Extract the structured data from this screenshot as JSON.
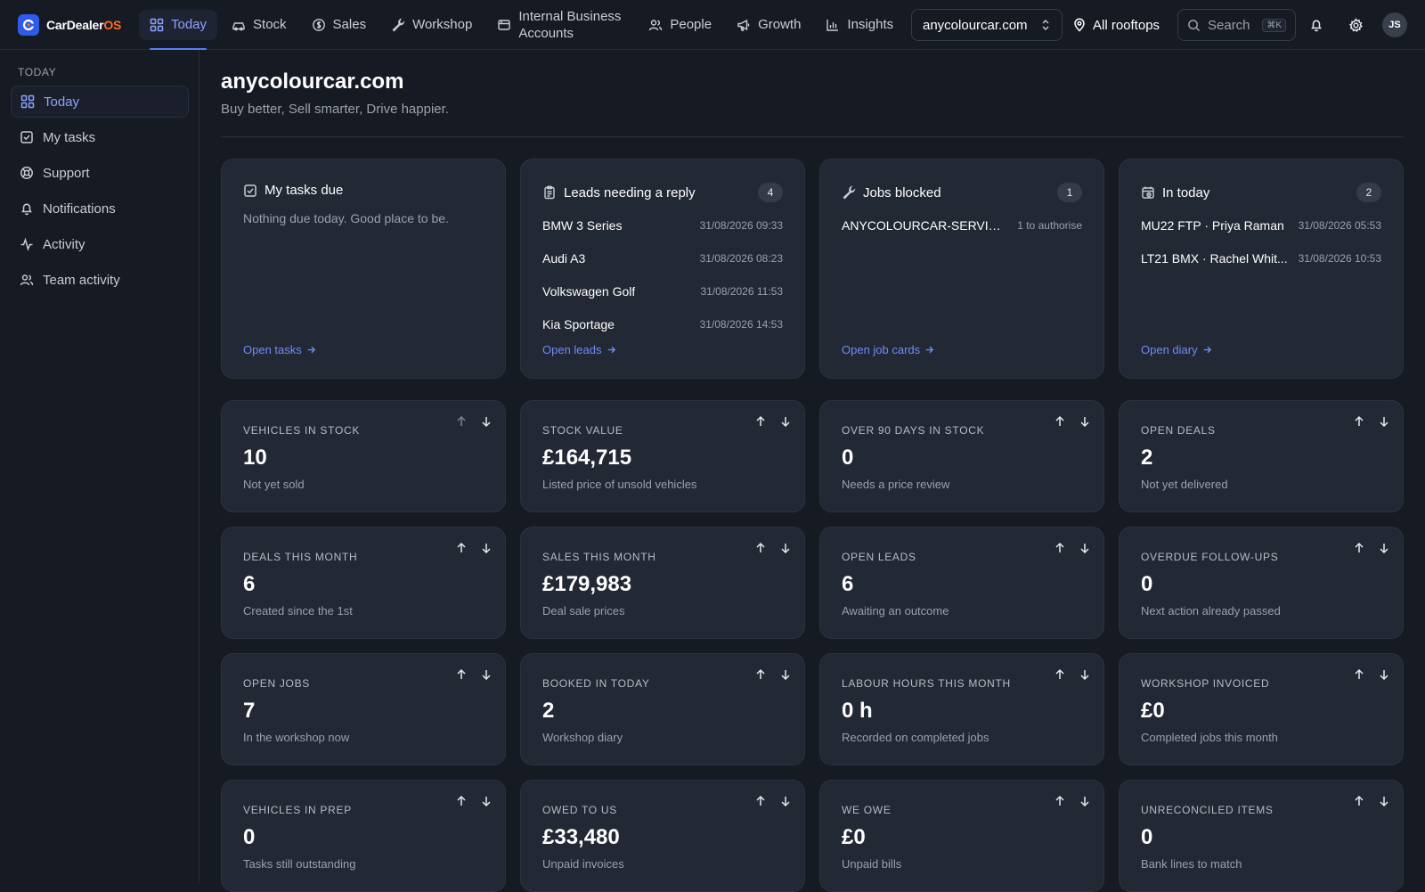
{
  "brand": {
    "name": "CarDealer",
    "suffix": "OS"
  },
  "nav": {
    "tabs": [
      {
        "label": "Today",
        "icon": "grid-icon"
      },
      {
        "label": "Stock",
        "icon": "car-icon"
      },
      {
        "label": "Sales",
        "icon": "coin-icon"
      },
      {
        "label": "Workshop",
        "icon": "wrench-icon"
      },
      {
        "label": "Internal Business Accounts",
        "icon": "ledger-icon"
      },
      {
        "label": "People",
        "icon": "people-icon"
      },
      {
        "label": "Growth",
        "icon": "megaphone-icon"
      },
      {
        "label": "Insights",
        "icon": "bar-chart-icon"
      }
    ],
    "domain_select": "anycolourcar.com",
    "rooftops": "All rooftops",
    "search_label": "Search",
    "search_shortcut": "⌘K",
    "avatar_initials": "JS"
  },
  "sidebar": {
    "heading": "TODAY",
    "items": [
      {
        "label": "Today",
        "icon": "grid-icon"
      },
      {
        "label": "My tasks",
        "icon": "checkbox-icon"
      },
      {
        "label": "Support",
        "icon": "lifebuoy-icon"
      },
      {
        "label": "Notifications",
        "icon": "bell-icon"
      },
      {
        "label": "Activity",
        "icon": "pulse-icon"
      },
      {
        "label": "Team activity",
        "icon": "people-icon"
      }
    ]
  },
  "page": {
    "title": "anycolourcar.com",
    "subtitle": "Buy better, Sell smarter, Drive happier."
  },
  "summary": {
    "tasks": {
      "title": "My tasks due",
      "empty": "Nothing due today. Good place to be.",
      "link": "Open tasks"
    },
    "leads": {
      "title": "Leads needing a reply",
      "count": "4",
      "rows": [
        {
          "title": "BMW 3 Series",
          "meta": "31/08/2026 09:33"
        },
        {
          "title": "Audi A3",
          "meta": "31/08/2026 08:23"
        },
        {
          "title": "Volkswagen Golf",
          "meta": "31/08/2026 11:53"
        },
        {
          "title": "Kia Sportage",
          "meta": "31/08/2026 14:53"
        }
      ],
      "link": "Open leads"
    },
    "jobs": {
      "title": "Jobs blocked",
      "count": "1",
      "rows": [
        {
          "title": "ANYCOLOURCAR-SERVICE...",
          "meta": "1 to authorise"
        }
      ],
      "link": "Open job cards"
    },
    "in_today": {
      "title": "In today",
      "count": "2",
      "rows": [
        {
          "title": "MU22 FTP · Priya Raman",
          "meta": "31/08/2026 05:53"
        },
        {
          "title": "LT21 BMX · Rachel Whit...",
          "meta": "31/08/2026 10:53"
        }
      ],
      "link": "Open diary"
    }
  },
  "stats": [
    {
      "label": "VEHICLES IN STOCK",
      "value": "10",
      "sub": "Not yet sold"
    },
    {
      "label": "STOCK VALUE",
      "value": "£164,715",
      "sub": "Listed price of unsold vehicles"
    },
    {
      "label": "OVER 90 DAYS IN STOCK",
      "value": "0",
      "sub": "Needs a price review"
    },
    {
      "label": "OPEN DEALS",
      "value": "2",
      "sub": "Not yet delivered"
    },
    {
      "label": "DEALS THIS MONTH",
      "value": "6",
      "sub": "Created since the 1st"
    },
    {
      "label": "SALES THIS MONTH",
      "value": "£179,983",
      "sub": "Deal sale prices"
    },
    {
      "label": "OPEN LEADS",
      "value": "6",
      "sub": "Awaiting an outcome"
    },
    {
      "label": "OVERDUE FOLLOW-UPS",
      "value": "0",
      "sub": "Next action already passed"
    },
    {
      "label": "OPEN JOBS",
      "value": "7",
      "sub": "In the workshop now"
    },
    {
      "label": "BOOKED IN TODAY",
      "value": "2",
      "sub": "Workshop diary"
    },
    {
      "label": "LABOUR HOURS THIS MONTH",
      "value": "0 h",
      "sub": "Recorded on completed jobs"
    },
    {
      "label": "WORKSHOP INVOICED",
      "value": "£0",
      "sub": "Completed jobs this month"
    },
    {
      "label": "VEHICLES IN PREP",
      "value": "0",
      "sub": "Tasks still outstanding"
    },
    {
      "label": "OWED TO US",
      "value": "£33,480",
      "sub": "Unpaid invoices"
    },
    {
      "label": "WE OWE",
      "value": "£0",
      "sub": "Unpaid bills"
    },
    {
      "label": "UNRECONCILED ITEMS",
      "value": "0",
      "sub": "Bank lines to match"
    }
  ],
  "colors": {
    "background": "#161a22",
    "card": "#232835",
    "accent": "#5b7cf6",
    "brand_suffix": "#ff6a2c"
  }
}
